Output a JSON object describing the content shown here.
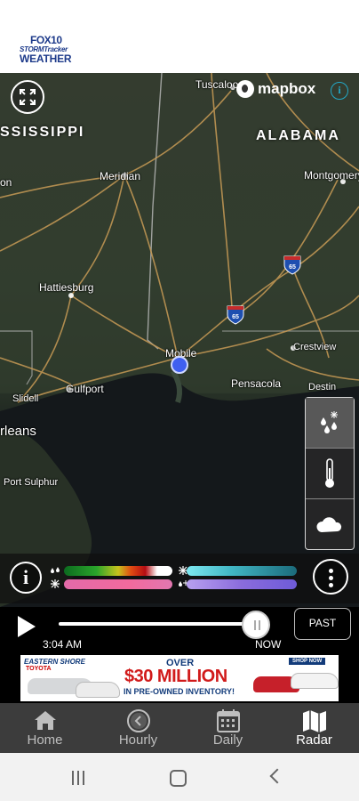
{
  "header": {
    "logo_line1": "FOX10",
    "logo_line2": "STORMTracker",
    "logo_line3": "WEATHER"
  },
  "map": {
    "attribution": "mapbox",
    "info_button": "i",
    "states": [
      "SSISSIPPI",
      "ALABAMA"
    ],
    "places": [
      "Tuscaloosa",
      "Meridian",
      "Montgomery",
      "on",
      "Hattiesburg",
      "Mobile",
      "Crestview",
      "Pensacola",
      "Destin",
      "Slidell",
      "Gulfport",
      "rleans",
      "Port Sulphur"
    ],
    "highway_shields": [
      "65",
      "65"
    ]
  },
  "layers": {
    "items": [
      "precip-layer",
      "temperature-layer",
      "cloud-layer"
    ]
  },
  "legend": {
    "info_label": "i",
    "bars": [
      "rain",
      "ice",
      "snow",
      "mix"
    ]
  },
  "timeline": {
    "time": "3:04 AM",
    "now_label": "NOW",
    "past_label": "PAST",
    "progress": 0.94
  },
  "ad": {
    "brand": "EASTERN SHORE",
    "brand_sub": "TOYOTA",
    "over": "OVER",
    "headline": "$30 MILLION",
    "subline": "IN PRE-OWNED INVENTORY!",
    "cta": "SHOP NOW"
  },
  "nav": {
    "items": [
      {
        "label": "Home",
        "icon": "home-icon"
      },
      {
        "label": "Hourly",
        "icon": "clock-icon"
      },
      {
        "label": "Daily",
        "icon": "calendar-icon"
      },
      {
        "label": "Radar",
        "icon": "map-icon"
      }
    ],
    "active": "Radar"
  },
  "colors": {
    "nav_bg": "#3c3c3c",
    "accent_blue": "#3f5ff0",
    "attribution_info": "#23a8c7"
  }
}
